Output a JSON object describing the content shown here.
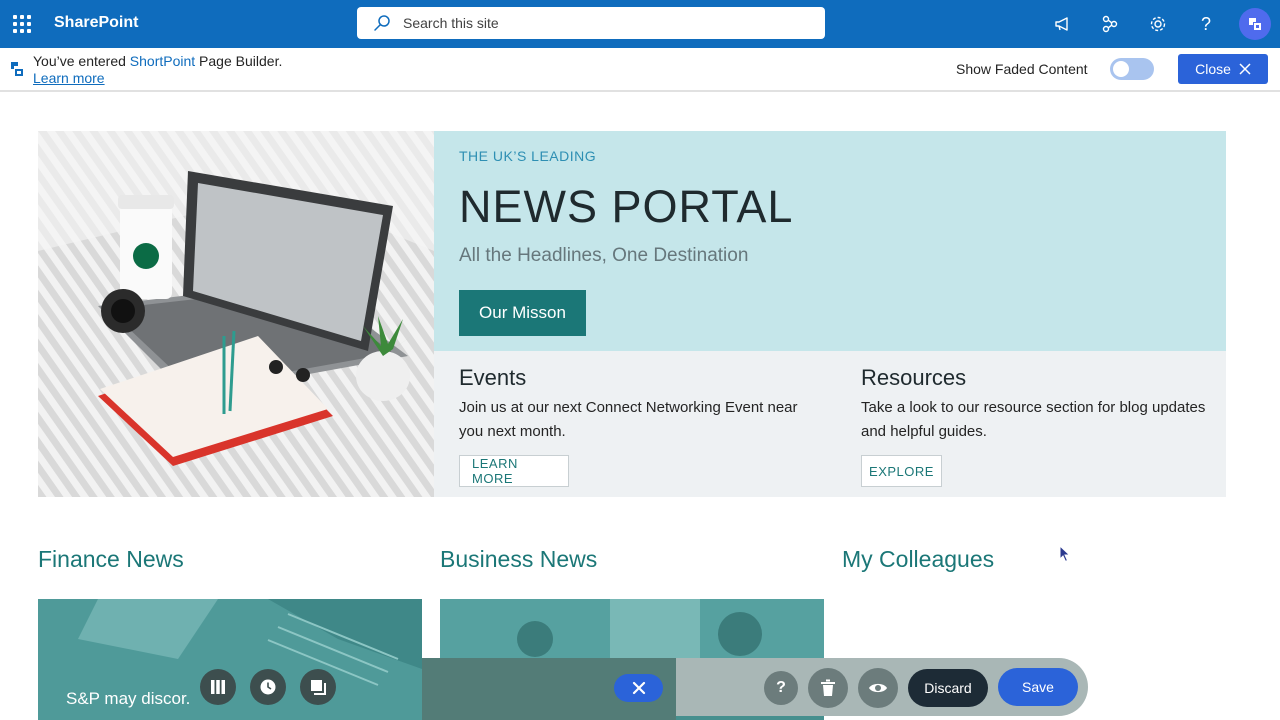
{
  "suite_bar": {
    "app_name": "SharePoint",
    "search_placeholder": "Search this site",
    "icons": [
      "waffle-icon",
      "search-icon",
      "megaphone-icon",
      "share-network-icon",
      "gear-icon",
      "help-icon",
      "avatar"
    ]
  },
  "shortpoint_bar": {
    "message_prefix": "You’ve entered ",
    "message_highlight": "ShortPoint",
    "message_suffix": " Page Builder.",
    "learn_more": "Learn more",
    "faded_label": "Show Faded Content",
    "faded_on": false,
    "close_label": "Close"
  },
  "hero": {
    "kicker": "THE UK’S LEADING",
    "headline": "NEWS PORTAL",
    "subhead": "All the Headlines, One Destination",
    "cta": "Our Misson"
  },
  "cards": [
    {
      "title": "Events",
      "text": "Join us at our next Connect Networking Event near you next month.",
      "button": "LEARN MORE"
    },
    {
      "title": "Resources",
      "text": "Take a look to our resource section for blog updates and helpful guides.",
      "button": "EXPLORE"
    }
  ],
  "sections": [
    "Finance News",
    "Business News",
    "My Colleagues"
  ],
  "toolbar": {
    "caption": "S&P may discor.",
    "discard": "Discard",
    "save": "Save"
  },
  "colors": {
    "suite_blue": "#0f6cbd",
    "teal": "#1b7777",
    "hero_band": "#c5e6ea",
    "primary_button": "#2b63d9"
  }
}
